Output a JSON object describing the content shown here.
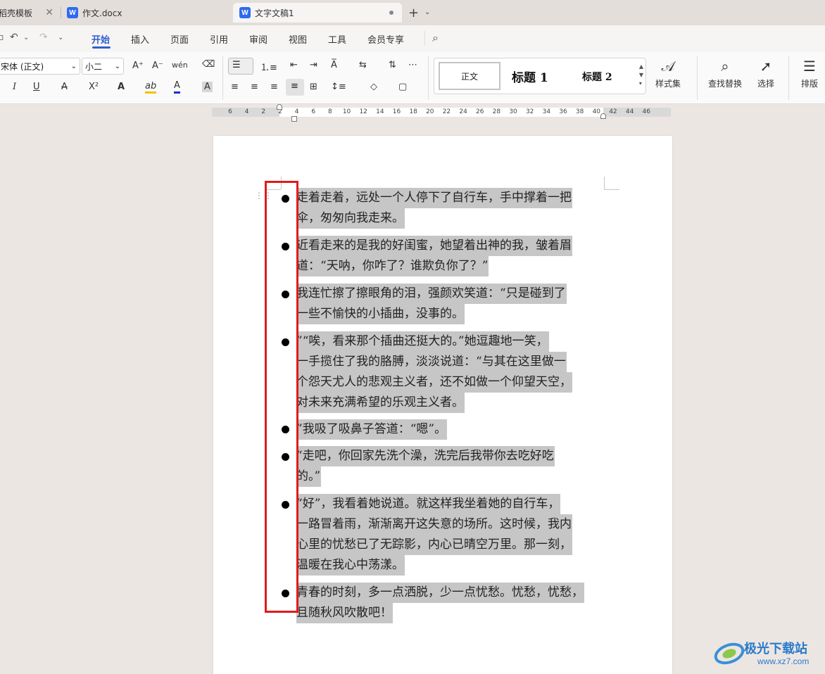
{
  "tabs": [
    {
      "label": "稻壳模板",
      "close": "✕"
    },
    {
      "label": "作文.docx",
      "icon": "W"
    },
    {
      "label": "文字文稿1",
      "icon": "W"
    }
  ],
  "tab_controls": {
    "new": "+",
    "dropdown": "⌄"
  },
  "quick_access": {
    "undo": "↶",
    "undo_dd": "⌄",
    "redo": "↷",
    "more": "⌄"
  },
  "menu": [
    "开始",
    "插入",
    "页面",
    "引用",
    "审阅",
    "视图",
    "工具",
    "会员专享"
  ],
  "ribbon": {
    "font_name": "宋体 (正文)",
    "font_size": "小二",
    "grow_font": "A⁺",
    "shrink_font": "A⁻",
    "phonetic": "wén",
    "clear_format": "⌫",
    "italic": "I",
    "underline": "U",
    "strike": "A",
    "superscript": "X²",
    "effects": "A",
    "highlight": "ab",
    "font_color": "A",
    "char_shading": "A",
    "styles": {
      "normal": "正文",
      "heading1": "标题 1",
      "heading2": "标题 2"
    },
    "style_set": "样式集",
    "find_replace": "查找替换",
    "select": "选择",
    "arrange": "排版"
  },
  "ruler_numbers": [
    "6",
    "4",
    "2",
    "2",
    "4",
    "6",
    "8",
    "10",
    "12",
    "14",
    "16",
    "18",
    "20",
    "22",
    "24",
    "26",
    "28",
    "30",
    "32",
    "34",
    "36",
    "38",
    "40",
    "42",
    "44",
    "46"
  ],
  "paragraphs": [
    {
      "lines": [
        "走着走着，远处一个人停下了自行车，手中撑着一把",
        "伞，匆匆向我走来。"
      ]
    },
    {
      "lines": [
        "近看走来的是我的好闺蜜，她望着出神的我，皱着眉",
        "道：“天呐，你咋了？谁欺负你了？”"
      ]
    },
    {
      "lines": [
        "我连忙擦了擦眼角的泪，强颜欢笑道：“只是碰到了",
        "一些不愉快的小插曲，没事的。"
      ]
    },
    {
      "lines": [
        "”“唉，看来那个插曲还挺大的。”她逗趣地一笑，",
        "一手揽住了我的胳膊，淡淡说道：“与其在这里做一",
        "个怨天尤人的悲观主义者，还不如做一个仰望天空，",
        "对未来充满希望的乐观主义者。"
      ]
    },
    {
      "lines": [
        "”我吸了吸鼻子答道：“嗯”。"
      ]
    },
    {
      "lines": [
        "“走吧，你回家先洗个澡，洗完后我带你去吃好吃",
        "的。”"
      ]
    },
    {
      "lines": [
        "“好”，我看着她说道。就这样我坐着她的自行车，",
        "一路冒着雨，渐渐离开这失意的场所。这时候，我内",
        "心里的忧愁已了无踪影，内心已晴空万里。那一刻，",
        "温暖在我心中荡漾。"
      ]
    },
    {
      "lines": [
        "青春的时刻，多一点洒脱，少一点忧愁。忧愁，忧愁，",
        "且随秋风吹散吧！"
      ]
    }
  ],
  "watermark": {
    "title": "极光下载站",
    "url": "www.xz7.com"
  },
  "colors": {
    "accent": "#2f5fd0",
    "selection": "#c6c6c6",
    "highlight_box": "#e01b1b",
    "font_color_bar": "#1a2fcc",
    "highlight_bar": "#f2c200"
  }
}
